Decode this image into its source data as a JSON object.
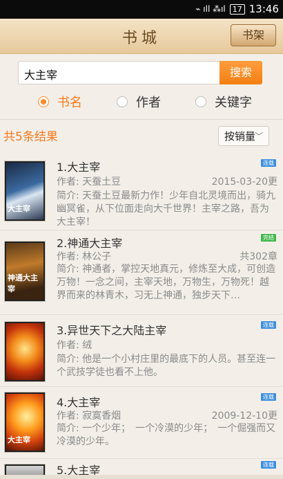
{
  "status": {
    "indicators": "⌁ ıll ⁂ıl",
    "badge": "17",
    "time": "13:46"
  },
  "topbar": {
    "title": "书城",
    "shelf_button": "书架"
  },
  "search": {
    "value": "大主宰",
    "button": "搜索"
  },
  "filters": [
    {
      "label": "书名",
      "selected": true
    },
    {
      "label": "作者",
      "selected": false
    },
    {
      "label": "关键字",
      "selected": false
    }
  ],
  "results": {
    "summary": "共5条结果",
    "sort": "按销量"
  },
  "books": [
    {
      "title": "1.大主宰",
      "tag": "连载",
      "tag_color": "#3d8fe0",
      "author": "作者: 天蚕土豆",
      "extra": "2015-03-20更",
      "desc": "简介: 天蚕土豆最新力作！少年自北灵境而出，骑九幽冥雀，从下位面走向大千世界！主宰之路，吾为大主宰！",
      "cover_text": "大主宰"
    },
    {
      "title": "2.神通大主宰",
      "tag": "完结",
      "tag_color": "#3fb74a",
      "author": "作者: 林公子",
      "extra": "共302章",
      "desc": "简介: 神通者，掌控天地真元，修炼至大成，可创造万物！一念之间，主宰天地，万物生，万物死！越界而来的林青木，习无上神通，独步天下…",
      "cover_text": "神通大主宰"
    },
    {
      "title": "3.异世天下之大陆主宰",
      "tag": "连载",
      "tag_color": "#3d8fe0",
      "author": "作者: 绒",
      "extra": "",
      "desc": "简介: 他是一个小村庄里的最底下的人员。甚至连一个武技学徒也看不上他。",
      "cover_text": ""
    },
    {
      "title": "4.大主宰",
      "tag": "连载",
      "tag_color": "#3d8fe0",
      "author": "作者: 寂寞香烟",
      "extra": "2009-12-10更",
      "desc": "简介: 一个少年；　一个冷漠的少年；　一个倔强而又冷漠的少年。",
      "cover_text": "大主宰"
    },
    {
      "title": "5.大主宰",
      "tag": "连载",
      "tag_color": "#3d8fe0",
      "author": "",
      "extra": "",
      "desc": "",
      "cover_text": ""
    }
  ]
}
